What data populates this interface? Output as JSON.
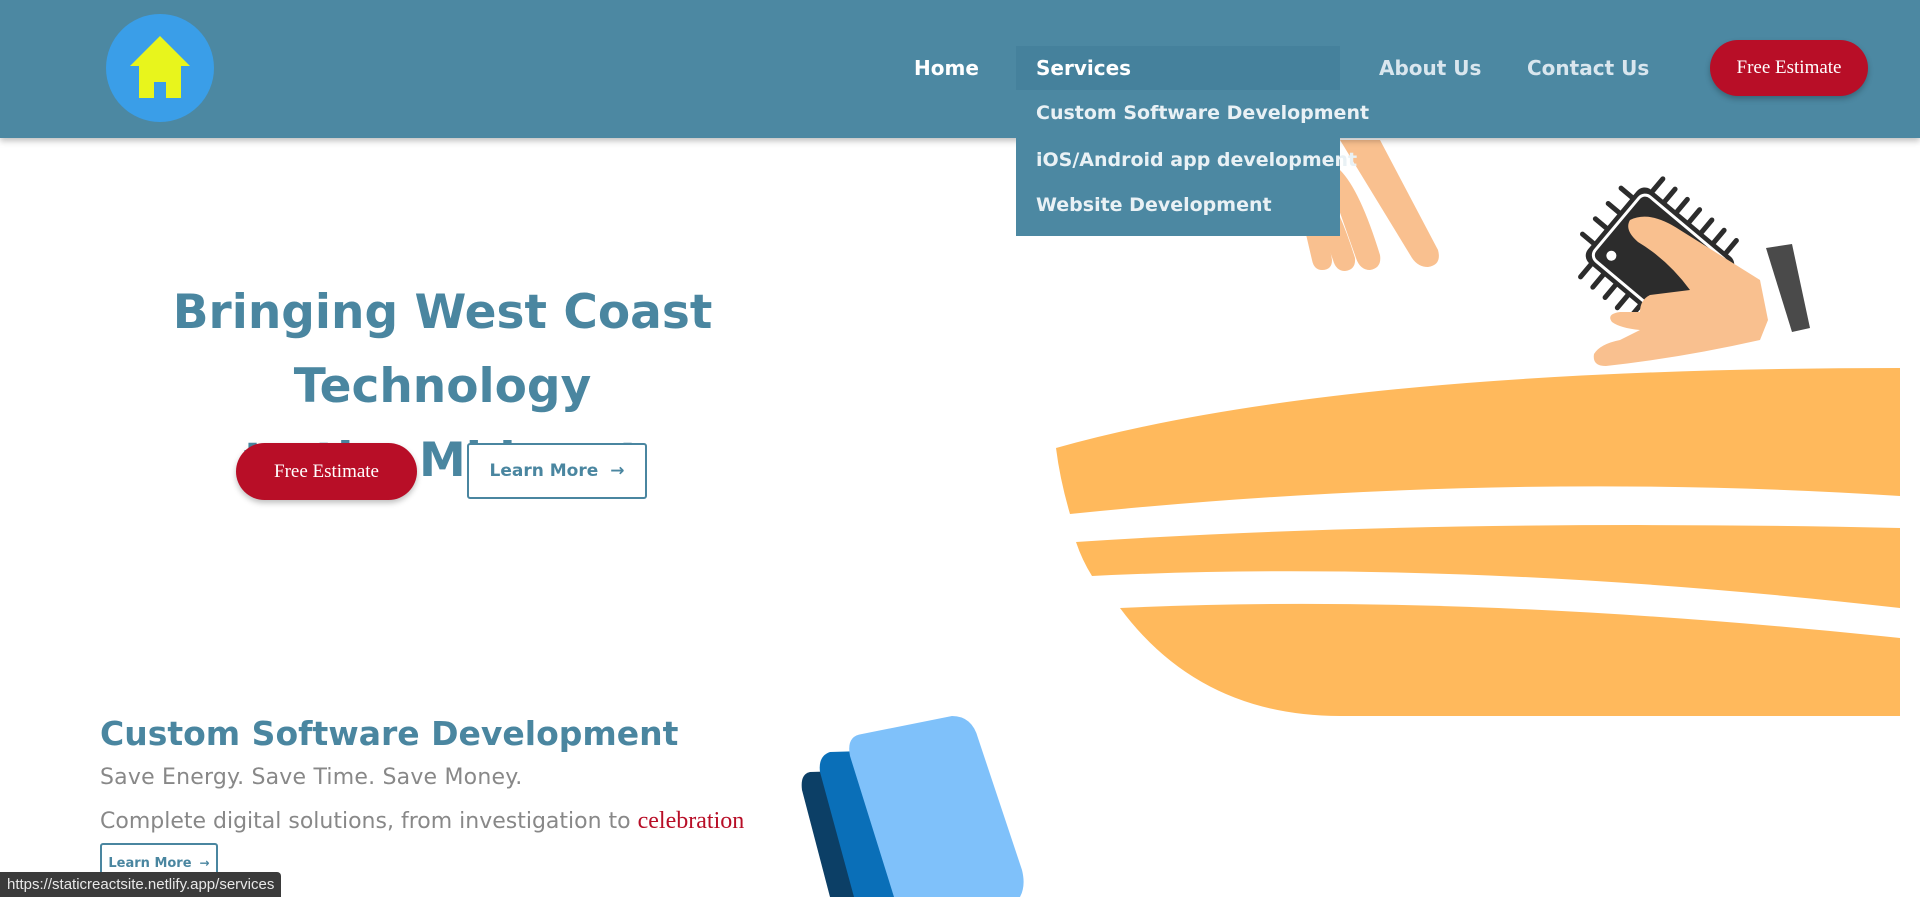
{
  "header": {
    "nav": {
      "home": "Home",
      "services": "Services",
      "about": "About Us",
      "contact": "Contact Us"
    },
    "services_dropdown": [
      "Custom Software Development",
      "iOS/Android app development",
      "Website Development"
    ],
    "cta_label": "Free Estimate"
  },
  "hero": {
    "title_line1": "Bringing West Coast Technology",
    "title_line2": "to the Midwest",
    "cta_label": "Free Estimate",
    "learn_more_label": "Learn More"
  },
  "section": {
    "title": "Custom Software Development",
    "tagline": "Save Energy. Save Time. Save Money.",
    "description": "Complete digital solutions, from investigation to",
    "description_highlight": "celebration",
    "learn_more_label": "Learn More"
  },
  "status_bar": {
    "url": "https://staticreactsite.netlify.app/services"
  },
  "icons": {
    "logo": "house-icon",
    "arrow": "arrow-right-icon"
  },
  "colors": {
    "header_bg": "#4c88a2",
    "accent_red": "#b80e27",
    "title_blue": "#4a86a0",
    "logo_circle": "#3a9ee8",
    "house": "#e8f51c",
    "illustration_orange": "#ffb95c"
  }
}
